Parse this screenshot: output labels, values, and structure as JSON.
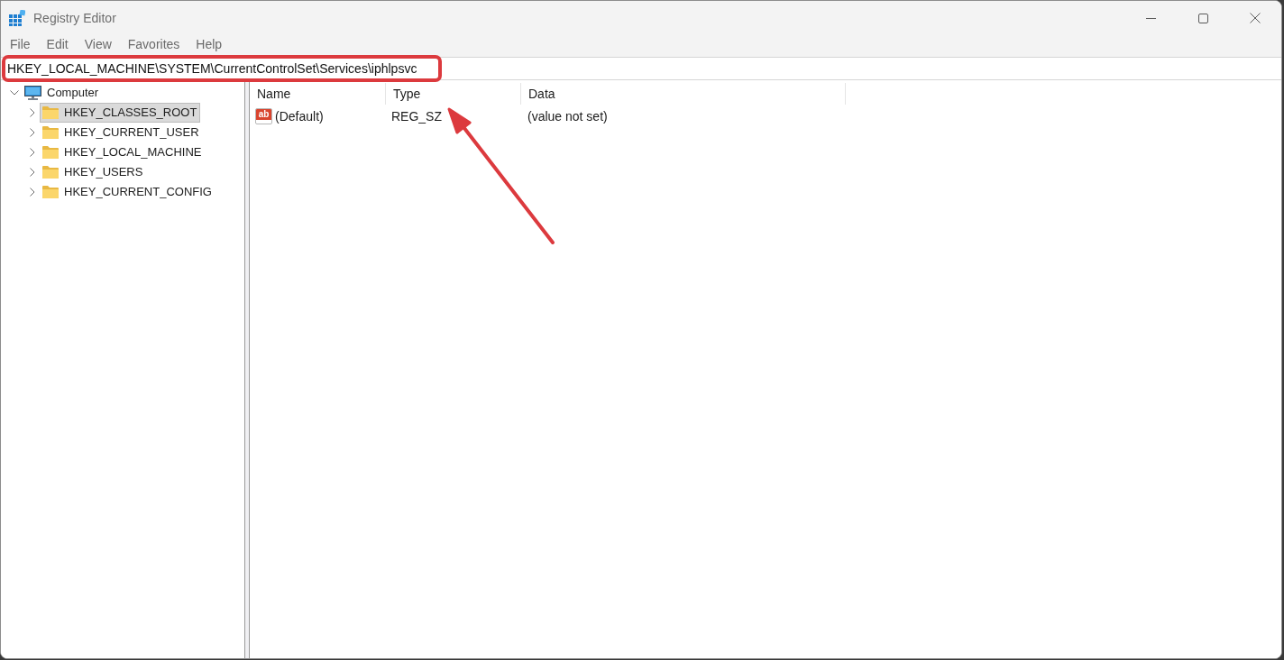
{
  "window": {
    "title": "Registry Editor"
  },
  "menu": [
    "File",
    "Edit",
    "View",
    "Favorites",
    "Help"
  ],
  "address_bar": {
    "value": "HKEY_LOCAL_MACHINE\\SYSTEM\\CurrentControlSet\\Services\\iphlpsvc"
  },
  "tree": [
    {
      "label": "Computer",
      "kind": "computer",
      "expanded": true,
      "selected": false,
      "children": [
        {
          "label": "HKEY_CLASSES_ROOT",
          "kind": "folder",
          "expanded": false,
          "selected": true
        },
        {
          "label": "HKEY_CURRENT_USER",
          "kind": "folder",
          "expanded": false,
          "selected": false
        },
        {
          "label": "HKEY_LOCAL_MACHINE",
          "kind": "folder",
          "expanded": false,
          "selected": false
        },
        {
          "label": "HKEY_USERS",
          "kind": "folder",
          "expanded": false,
          "selected": false
        },
        {
          "label": "HKEY_CURRENT_CONFIG",
          "kind": "folder",
          "expanded": false,
          "selected": false
        }
      ]
    }
  ],
  "values_table": {
    "columns": [
      "Name",
      "Type",
      "Data"
    ],
    "rows": [
      {
        "kind": "string",
        "icon": "ab",
        "name": "(Default)",
        "type": "REG_SZ",
        "data": "(value not set)"
      }
    ]
  }
}
